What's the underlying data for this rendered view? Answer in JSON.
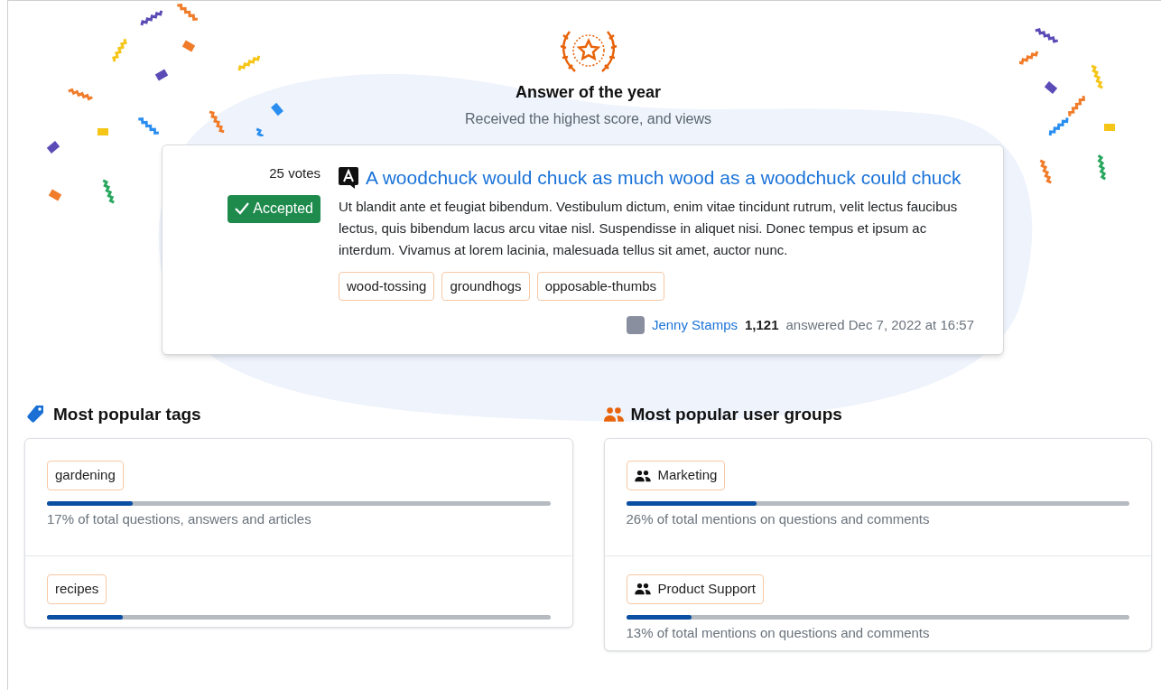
{
  "award": {
    "title": "Answer of the year",
    "subtitle": "Received the highest score, and views"
  },
  "answer": {
    "votes": "25 votes",
    "accepted": true,
    "accepted_label": "Accepted",
    "title": "A woodchuck would chuck as much wood as a woodchuck could chuck",
    "body": "Ut blandit ante et feugiat bibendum. Vestibulum dictum, enim vitae tincidunt rutrum, velit lectus faucibus lectus, quis bibendum lacus arcu vitae nisl. Suspendisse in aliquet nisi. Donec tempus et ipsum ac interdum. Vivamus at lorem lacinia, malesuada tellus sit amet, auctor nunc.",
    "tags": [
      "wood-tossing",
      "groundhogs",
      "opposable-thumbs"
    ],
    "author": "Jenny Stamps",
    "reputation": "1,121",
    "answered": "answered Dec 7, 2022 at 16:57"
  },
  "sections": [
    {
      "kind": "tags",
      "title": "Most popular tags",
      "items": [
        {
          "label": "gardening",
          "level": 0.17,
          "caption": "17% of total questions, answers and articles"
        },
        {
          "label": "recipes",
          "level": 0.15
        }
      ]
    },
    {
      "kind": "groups",
      "title": "Most popular user groups",
      "items": [
        {
          "label": "Marketing",
          "level": 0.26,
          "caption": "26% of total mentions on questions and comments"
        },
        {
          "label": "Product Support",
          "level": 0.13,
          "caption": "13% of total mentions on questions and comments"
        }
      ]
    }
  ]
}
